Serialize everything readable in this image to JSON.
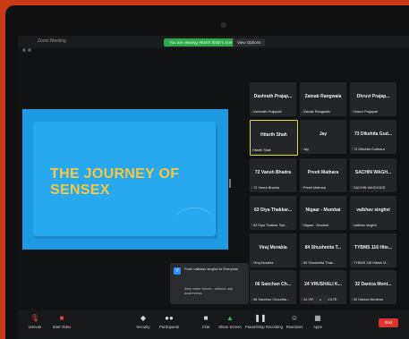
{
  "window": {
    "title": "Zoom Meeting"
  },
  "banner": {
    "share_text": "You are viewing Hitarth Shah's screen",
    "view_options": "View Options"
  },
  "slide": {
    "title_line1": "THE JOURNEY OF",
    "title_line2": "SENSEX"
  },
  "participants": [
    {
      "name": "Dashrath Prajap...",
      "label": "Dashrath Prajapati",
      "muted": true
    },
    {
      "name": "Zainab Rangwala",
      "label": "Zainab Rangwala",
      "muted": true
    },
    {
      "name": "Dhruvi Prajap...",
      "label": "Dhruvi Prajapati",
      "muted": true
    },
    {
      "name": "Hitarth Shah",
      "label": "Hitarth Shah",
      "muted": false,
      "active": true
    },
    {
      "name": "Jay",
      "label": "Jay",
      "muted": true
    },
    {
      "name": "73 Dikshita Gud...",
      "label": "73 Dikshita Gudhara",
      "muted": true
    },
    {
      "name": "72 Vansh Bhadra",
      "label": "72 Vansh Bhadra",
      "muted": true
    },
    {
      "name": "Preeti Mathara",
      "label": "Preeti Mathara",
      "muted": true
    },
    {
      "name": "SACHIN WAGH...",
      "label": "SACHIN WAGHODE",
      "muted": true
    },
    {
      "name": "63 Diya Thakkar...",
      "label": "63 Diya Thakkar Syb...",
      "muted": true
    },
    {
      "name": "Nigaar - Mumbai",
      "label": "Nigaar - Mumbai",
      "muted": true
    },
    {
      "name": "vaibhav singhvi",
      "label": "vaibhav singhvi",
      "muted": true
    },
    {
      "name": "Viraj Morabia",
      "label": "Viraj Morabia",
      "muted": true
    },
    {
      "name": "84 Shushmita T...",
      "label": "84 Shushmita Thak...",
      "muted": true
    },
    {
      "name": "TYBMS 116 Hite...",
      "label": "TYBMS 116 Hitesh M...",
      "muted": true
    },
    {
      "name": "06 Sanchan Ch...",
      "label": "06 Sanchan Choudha...",
      "muted": true
    },
    {
      "name": "24 VRUSHALI K...",
      "label": "24 VRUSHALI KOLTE",
      "muted": true
    },
    {
      "name": "32 Danica Mont...",
      "label": "32 Danica Monteiro",
      "muted": true
    }
  ],
  "chat": {
    "from": "From vaibhav singhvi to Everyone",
    "message": "they make forces...without any awareness",
    "avatar": "V"
  },
  "toolbar": {
    "unmute": "Unmute",
    "start_video": "Start Video",
    "security": "Security",
    "participants": "Participants",
    "participants_count": "18",
    "chat": "Chat",
    "share_screen": "Share Screen",
    "record": "Pause/Stop Recording",
    "reactions": "Reactions",
    "apps": "Apps",
    "end": "End"
  }
}
